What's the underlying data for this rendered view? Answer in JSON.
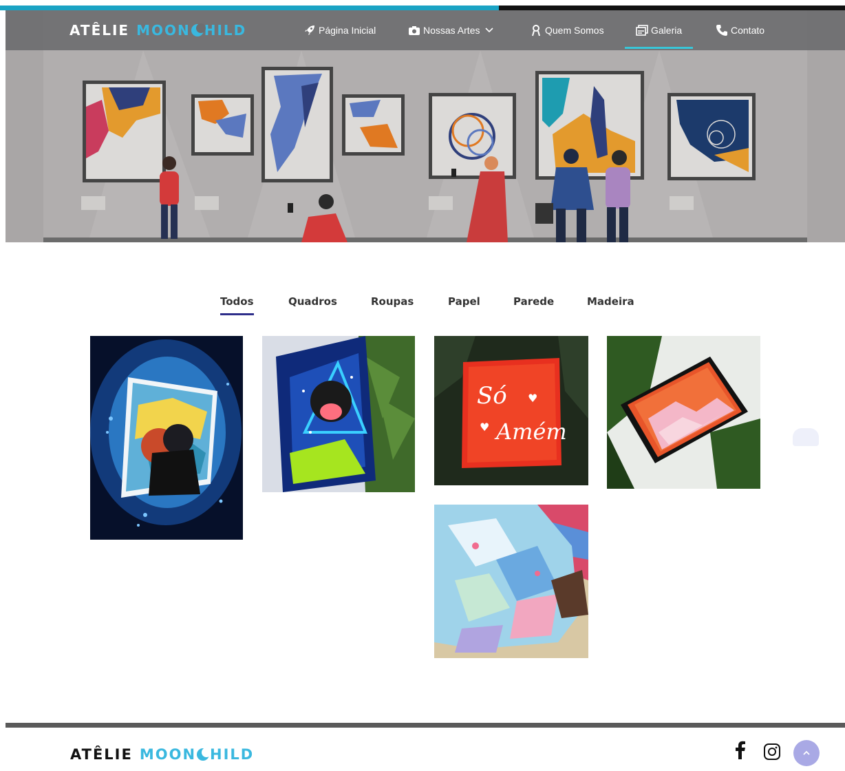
{
  "progress": {
    "value": 0.59,
    "color": "#1aa3c4"
  },
  "brand": {
    "word1": "ATÊLIE",
    "word2": "MOON",
    "word3": "HILD",
    "accent": "#3ab8df"
  },
  "nav": {
    "items": [
      {
        "label": "Página Inicial",
        "icon": "rocket-icon"
      },
      {
        "label": "Nossas Artes",
        "icon": "camera-icon"
      },
      {
        "label": "Quem Somos",
        "icon": "user-icon"
      },
      {
        "label": "Galeria",
        "icon": "gallery-icon",
        "active": true
      },
      {
        "label": "Contato",
        "icon": "phone-icon"
      }
    ]
  },
  "filters": {
    "tabs": [
      "Todos",
      "Quadros",
      "Roupas",
      "Papel",
      "Parede",
      "Madeira"
    ],
    "active": "Todos"
  },
  "gallery": {
    "items": [
      {
        "subject": "portrait-painting"
      },
      {
        "subject": "dog-painting"
      },
      {
        "subject": "lettering-painting",
        "text_line1": "Só",
        "text_line2": "Amém"
      },
      {
        "subject": "red-abstract-painting"
      },
      {
        "subject": "tie-dye-shirt"
      }
    ]
  },
  "footer": {
    "social": [
      "facebook-icon",
      "instagram-icon"
    ],
    "to_top": "chevron-up-icon"
  }
}
